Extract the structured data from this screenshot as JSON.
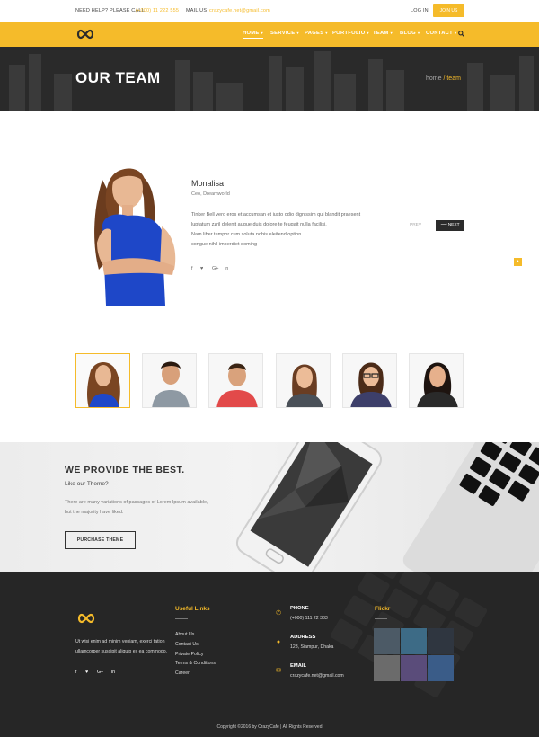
{
  "topbar": {
    "help_label": "NEED HELP? PLEASE CALL",
    "help_phone": "(+000) 11 222 555",
    "mail_label": "MAIL US",
    "mail_value": "crazycafe.net@gmail.com",
    "login": "LOG IN",
    "join": "JOIN US"
  },
  "nav": {
    "items": [
      {
        "label": "HOME",
        "active": true
      },
      {
        "label": "SERVICE"
      },
      {
        "label": "PAGES"
      },
      {
        "label": "PORTFOLIO"
      },
      {
        "label": "TEAM"
      },
      {
        "label": "BLOG"
      },
      {
        "label": "CONTACT"
      }
    ]
  },
  "hero": {
    "title": "OUR TEAM",
    "crumb_home": "home",
    "crumb_current": "/ team"
  },
  "member": {
    "name": "Monalisa",
    "role": "Ceo, Dreamworld",
    "bio": [
      "Tinker Bell vero eros et accumsan et iusto odio dignissim qui blandit praesent",
      "luptatum zzril delenit augue duis dolore te feugait nulla facilisi.",
      "Nam liber tempor cum soluta nobis eleifend option",
      "congue nihil imperdiet doming"
    ],
    "prev": "PREV",
    "next": "NEXT"
  },
  "social_icons": [
    "facebook-icon",
    "twitter-icon",
    "google-plus-icon",
    "linkedin-icon"
  ],
  "provide": {
    "title": "WE PROVIDE THE BEST.",
    "subtitle": "Like our Theme?",
    "text": "There are many variations of passages of Lorem Ipsum available, but the majority have liked.",
    "button": "PURCHASE THEME"
  },
  "footer": {
    "about": "Ut wisi enim ad minim veniam, exerci tation ullamcorper suscipit aliquip ex ea commodo.",
    "useful_title": "Useful Links",
    "links": [
      "About Us",
      "Contact Us",
      "Private Policy",
      "Terms & Conditions",
      "Career"
    ],
    "phone_label": "PHONE",
    "phone_value": "(+000) 111 22 333",
    "address_label": "ADDRESS",
    "address_value": "123, Siampur, Dhaka",
    "email_label": "EMAIL",
    "email_value": "crazycafe.net@gmail.com",
    "flickr_title": "Flickr",
    "copyright": "Copyright ©2016 by CrazyCafe   |   All Rights Reserved"
  },
  "colors": {
    "accent": "#f5bb2a",
    "dark": "#262626"
  }
}
